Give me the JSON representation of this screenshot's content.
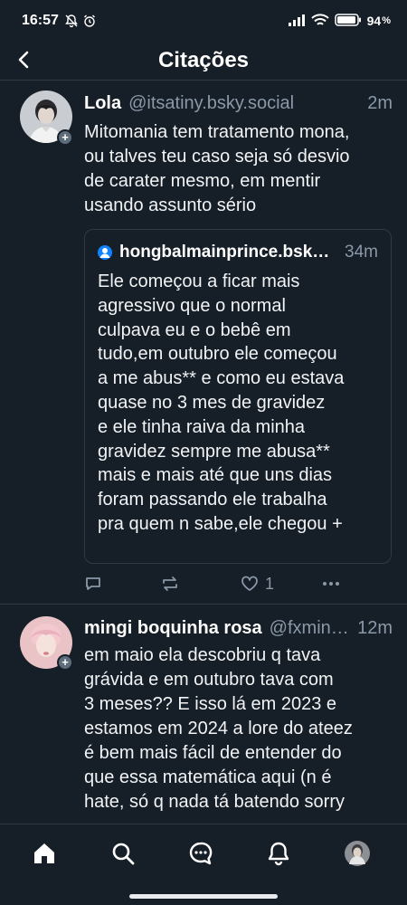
{
  "status_bar": {
    "time": "16:57",
    "battery": "94"
  },
  "header": {
    "title": "Citações"
  },
  "posts": [
    {
      "author_name": "Lola",
      "handle": "@itsatiny.bsky.social",
      "time": "2m",
      "text": "Mitomania tem tratamento mona,\nou talves teu caso seja só desvio\nde carater mesmo, em mentir\nusando assunto sério",
      "quote": {
        "author": "hongbalmainprince.bsky.social",
        "time": "34m",
        "text": "Ele começou a ficar mais\nagressivo que o normal\nculpava eu e o bebê em\ntudo,em outubro ele começou\na me abus** e como eu estava\nquase no 3 mes de gravidez\ne ele tinha raiva da minha\ngravidez sempre me abusa**\nmais e mais até que uns dias\nforam passando ele trabalha\npra quem n sabe,ele chegou +"
      },
      "like_count": "1"
    },
    {
      "author_name": "mingi boquinha rosa",
      "handle": "@fxmingi.bsky.social",
      "time": "12m",
      "text": "em maio ela descobriu q tava\ngrávida e em outubro tava com\n3 meses?? E isso lá em 2023 e\nestamos em 2024 a lore do ateez\né bem mais fácil de entender do\nque essa matemática aqui (n é\nhate, só q nada tá batendo sorry"
    }
  ],
  "colors": {
    "background": "#161e27",
    "accent": "#1083fe",
    "muted": "#8a98a8",
    "border": "#2e3a46"
  },
  "icons": [
    "back-arrow-icon",
    "reply-icon",
    "repost-icon",
    "like-icon",
    "more-icon",
    "home-icon",
    "search-icon",
    "chat-icon",
    "bell-icon"
  ]
}
